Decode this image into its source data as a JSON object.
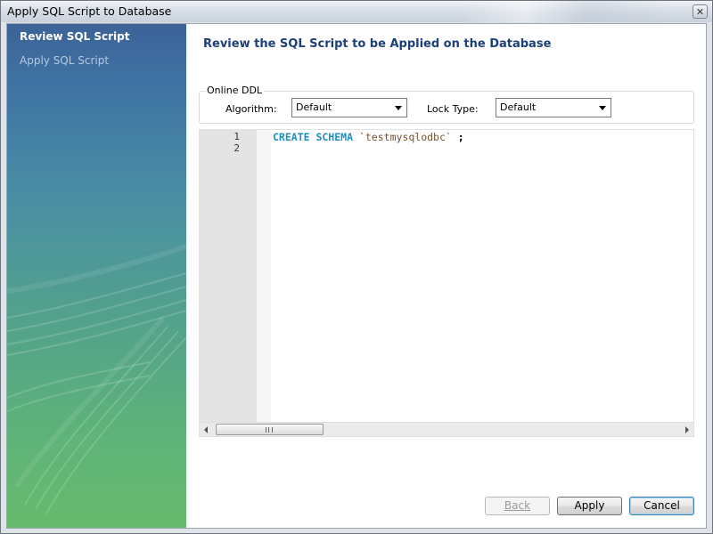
{
  "window": {
    "title": "Apply SQL Script to Database",
    "close_glyph": "✕",
    "close_icon": "close-icon"
  },
  "wizard": {
    "steps": [
      {
        "label": "Review SQL Script",
        "active": true
      },
      {
        "label": "Apply SQL Script",
        "active": false
      }
    ]
  },
  "main": {
    "title": "Review the SQL Script to be Applied on the Database",
    "online_ddl": {
      "legend": "Online DDL",
      "algorithm_label": "Algorithm:",
      "algorithm_value": "Default",
      "lock_type_label": "Lock Type:",
      "lock_type_value": "Default"
    },
    "editor": {
      "line_numbers": [
        "1",
        "2"
      ],
      "code": {
        "keyword": "CREATE SCHEMA",
        "identifier": "`testmysqlodbc`",
        "terminator": ";"
      }
    }
  },
  "buttons": {
    "back": "Back",
    "apply": "Apply",
    "cancel": "Cancel"
  },
  "colors": {
    "sql_keyword": "#1a8fc8",
    "sql_identifier": "#7a5230",
    "page_title": "#1d3f7a",
    "sidebar_top": "#3c6398",
    "sidebar_bottom": "#66ba6c"
  }
}
